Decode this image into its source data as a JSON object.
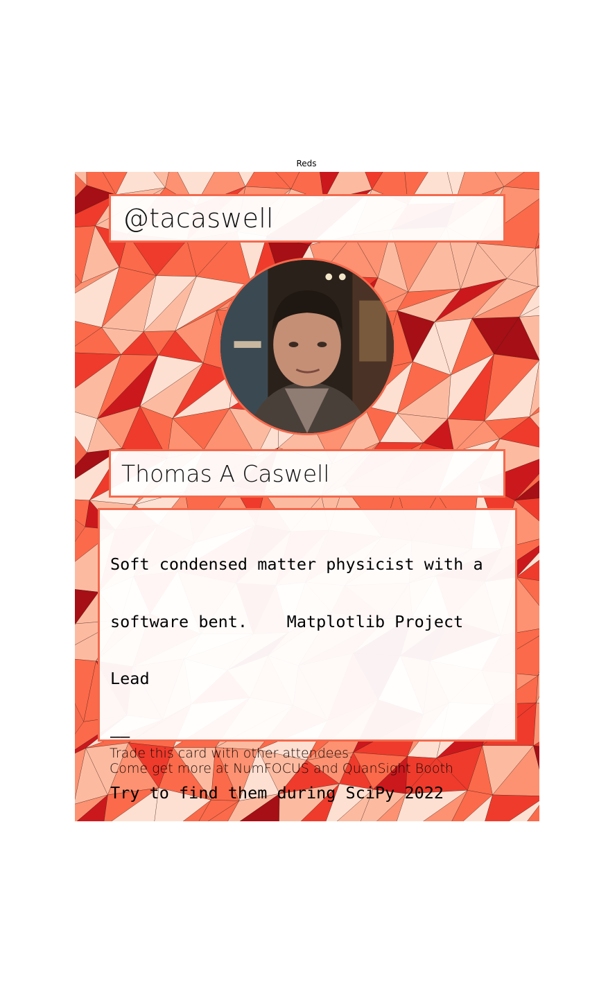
{
  "figure": {
    "title": "Reds"
  },
  "card": {
    "handle": "@tacaswell",
    "name": "Thomas A Caswell",
    "bio_lines": [
      "Soft condensed matter physicist with a",
      "software bent.    Matplotlib Project",
      "Lead",
      "——",
      "Try to find them during SciPy 2022"
    ],
    "footer_lines": [
      "Trade this card with other attendees.",
      "Come get more at NumFOCUS and QuanSight Booth"
    ],
    "avatar_icon": "profile-photo",
    "colors": {
      "accent": "#f4694c",
      "palette": [
        "#fee0d2",
        "#fcbba1",
        "#fc9272",
        "#fb6a4a",
        "#ef3b2c",
        "#cb181d",
        "#a50f15"
      ]
    }
  }
}
